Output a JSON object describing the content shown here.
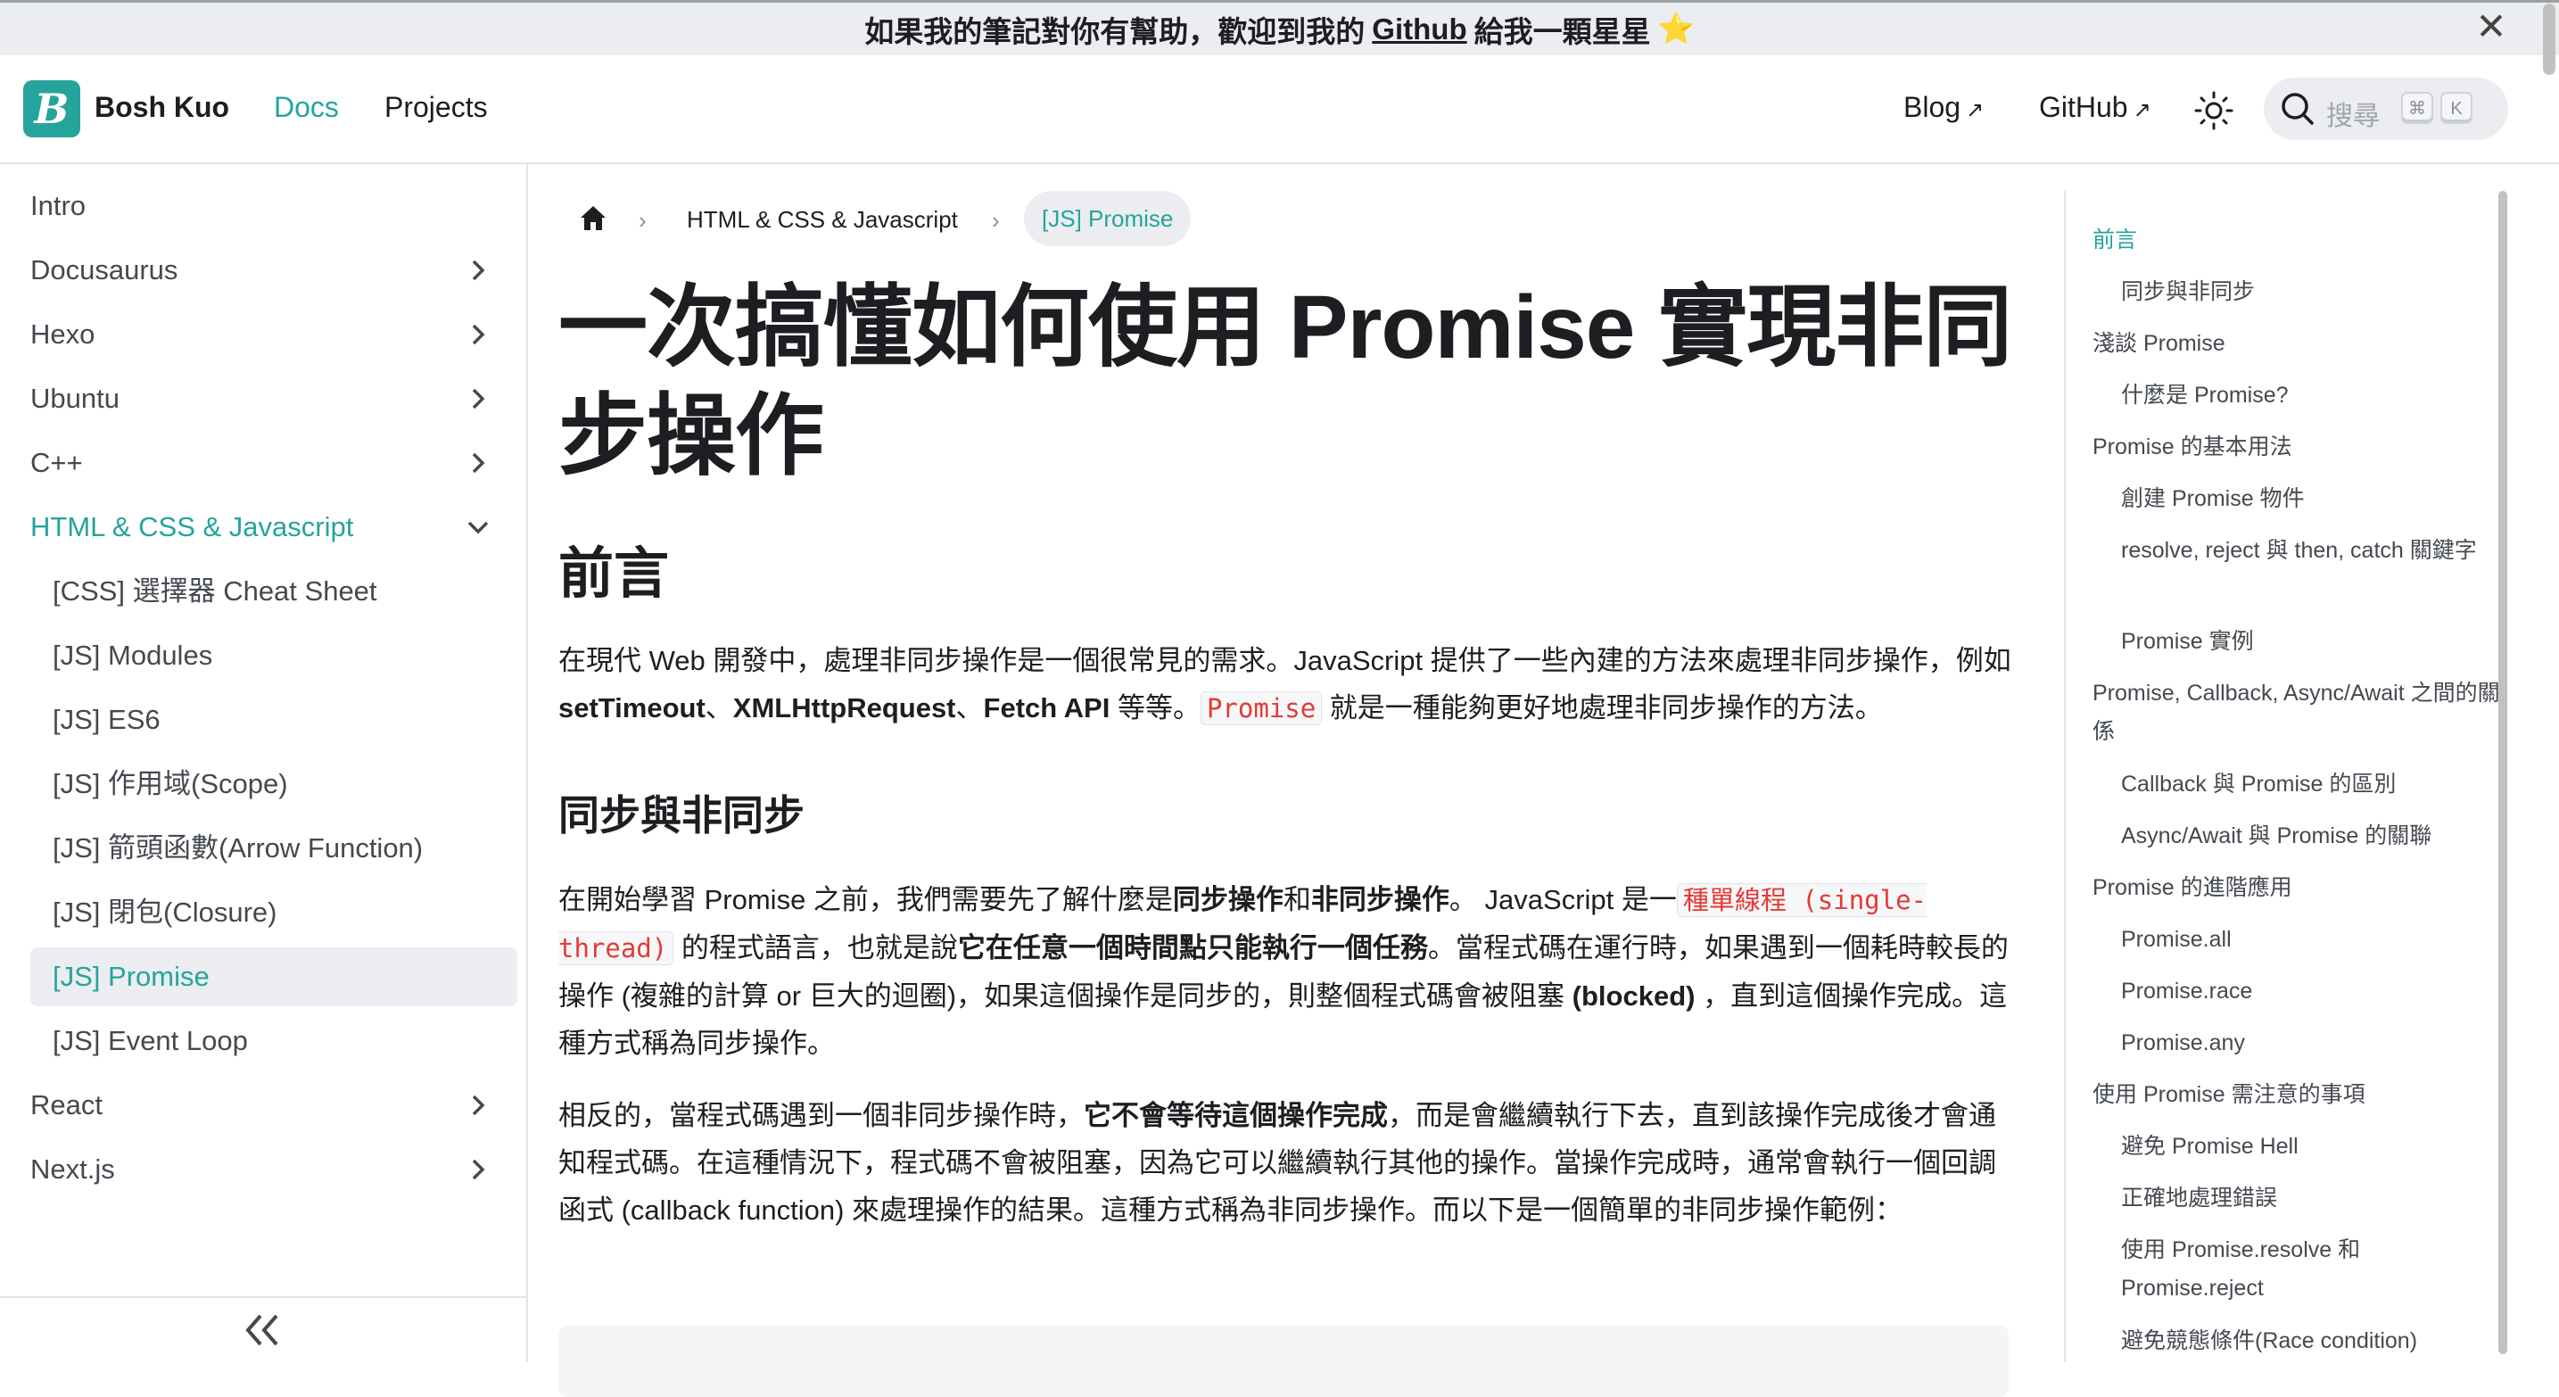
{
  "announcement": {
    "prefix": "如果我的筆記對你有幫助，歡迎到我的",
    "link": "Github",
    "suffix": "給我一顆星星",
    "star": "⭐"
  },
  "navbar": {
    "brand": "Bosh Kuo",
    "logo_letter": "B",
    "docs": "Docs",
    "projects": "Projects",
    "blog": "Blog",
    "github": "GitHub",
    "search_placeholder": "搜尋",
    "kbd_cmd": "⌘",
    "kbd_k": "K"
  },
  "sidebar": {
    "items": [
      {
        "label": "Intro"
      },
      {
        "label": "Docusaurus"
      },
      {
        "label": "Hexo"
      },
      {
        "label": "Ubuntu"
      },
      {
        "label": "C++"
      },
      {
        "label": "HTML & CSS & Javascript"
      },
      {
        "label": "[CSS] 選擇器 Cheat Sheet"
      },
      {
        "label": "[JS] Modules"
      },
      {
        "label": "[JS] ES6"
      },
      {
        "label": "[JS] 作用域(Scope)"
      },
      {
        "label": "[JS] 箭頭函數(Arrow Function)"
      },
      {
        "label": "[JS] 閉包(Closure)"
      },
      {
        "label": "[JS] Promise"
      },
      {
        "label": "[JS] Event Loop"
      },
      {
        "label": "React"
      },
      {
        "label": "Next.js"
      }
    ]
  },
  "breadcrumb": {
    "section": "HTML & CSS & Javascript",
    "current": "[JS] Promise"
  },
  "article": {
    "title": "一次搞懂如何使用 Promise 實現非同步操作",
    "h2_intro": "前言",
    "p1_a": "在現代 Web 開發中，處理非同步操作是一個很常見的需求。JavaScript 提供了一些內建的方法來處理非同步操作，例如 ",
    "p1_b1": "setTimeout",
    "p1_sep1": "、",
    "p1_b2": "XMLHttpRequest",
    "p1_sep2": "、",
    "p1_b3": "Fetch API",
    "p1_c": " 等等。",
    "p1_code": "Promise",
    "p1_d": " 就是一種能夠更好地處理非同步操作的方法。",
    "h3_sync": "同步與非同步",
    "p2_a": "在開始學習 Promise 之前，我們需要先了解什麼是",
    "p2_b1": "同步操作",
    "p2_and": "和",
    "p2_b2": "非同步操作",
    "p2_c": "。 JavaScript 是一",
    "p2_code": "種單線程 (single-thread)",
    "p2_d": " 的程式語言，也就是說",
    "p2_b3": "它在任意一個時間點只能執行一個任務",
    "p2_e": "。當程式碼在運行時，如果遇到一個耗時較長的操作 (複雜的計算 or 巨大的迴圈)，如果這個操作是同步的，則整個程式碼會被阻塞 ",
    "p2_b4": "(blocked)",
    "p2_f": " ，直到這個操作完成。這種方式稱為同步操作。",
    "p3_a": "相反的，當程式碼遇到一個非同步操作時，",
    "p3_b": "它不會等待這個操作完成",
    "p3_c": "，而是會繼續執行下去，直到該操作完成後才會通知程式碼。在這種情況下，程式碼不會被阻塞，因為它可以繼續執行其他的操作。當操作完成時，通常會執行一個回調函式 (callback function) 來處理操作的結果。這種方式稱為非同步操作。而以下是一個簡單的非同步操作範例："
  },
  "toc": {
    "items": [
      {
        "label": "前言"
      },
      {
        "label": "同步與非同步"
      },
      {
        "label": "淺談 Promise"
      },
      {
        "label": "什麼是 Promise?"
      },
      {
        "label": "Promise 的基本用法"
      },
      {
        "label": "創建 Promise 物件"
      },
      {
        "label": "resolve, reject 與 then, catch 關鍵字"
      },
      {
        "label": "Promise 實例"
      },
      {
        "label": "Promise, Callback, Async/Await 之間的關係"
      },
      {
        "label": "Callback 與 Promise 的區別"
      },
      {
        "label": "Async/Await 與 Promise 的關聯"
      },
      {
        "label": "Promise 的進階應用"
      },
      {
        "label": "Promise.all"
      },
      {
        "label": "Promise.race"
      },
      {
        "label": "Promise.any"
      },
      {
        "label": "使用 Promise 需注意的事項"
      },
      {
        "label": "避免 Promise Hell"
      },
      {
        "label": "正確地處理錯誤"
      },
      {
        "label": "使用 Promise.resolve 和 Promise.reject"
      },
      {
        "label": "避免競態條件(Race condition)"
      }
    ]
  },
  "colors": {
    "accent": "#25a49c",
    "inline_code": "#e53935"
  }
}
